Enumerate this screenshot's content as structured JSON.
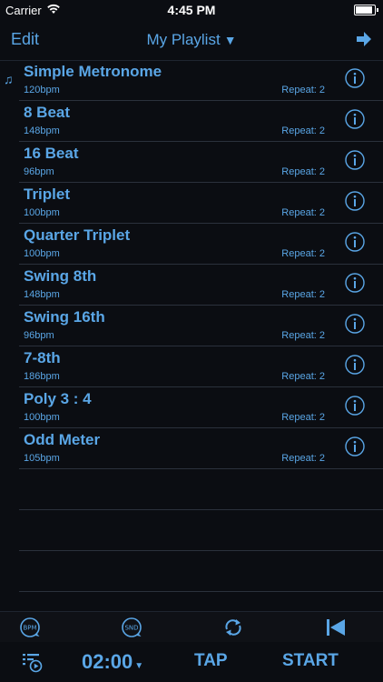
{
  "status": {
    "carrier": "Carrier",
    "time": "4:45 PM"
  },
  "nav": {
    "edit_label": "Edit",
    "title": "My Playlist",
    "title_caret": "▼"
  },
  "playlist": {
    "now_playing_glyph": "♫",
    "items": [
      {
        "name": "Simple Metronome",
        "bpm": "120bpm",
        "repeat": "Repeat: 2"
      },
      {
        "name": "8 Beat",
        "bpm": "148bpm",
        "repeat": "Repeat: 2"
      },
      {
        "name": "16 Beat",
        "bpm": "96bpm",
        "repeat": "Repeat: 2"
      },
      {
        "name": "Triplet",
        "bpm": "100bpm",
        "repeat": "Repeat: 2"
      },
      {
        "name": "Quarter Triplet",
        "bpm": "100bpm",
        "repeat": "Repeat: 2"
      },
      {
        "name": "Swing 8th",
        "bpm": "148bpm",
        "repeat": "Repeat: 2"
      },
      {
        "name": "Swing 16th",
        "bpm": "96bpm",
        "repeat": "Repeat: 2"
      },
      {
        "name": "7-8th",
        "bpm": "186bpm",
        "repeat": "Repeat: 2"
      },
      {
        "name": "Poly 3 : 4",
        "bpm": "100bpm",
        "repeat": "Repeat: 2"
      },
      {
        "name": "Odd Meter",
        "bpm": "105bpm",
        "repeat": "Repeat: 2"
      }
    ]
  },
  "toolbar": {
    "bpm_label": "BPM",
    "snd_label": "SND"
  },
  "controls": {
    "timer": "02:00",
    "timer_caret": "▼",
    "tap_label": "TAP",
    "start_label": "START"
  },
  "colors": {
    "accent": "#5aa6e6",
    "background": "#0b0d12",
    "separator": "#2b313c"
  }
}
